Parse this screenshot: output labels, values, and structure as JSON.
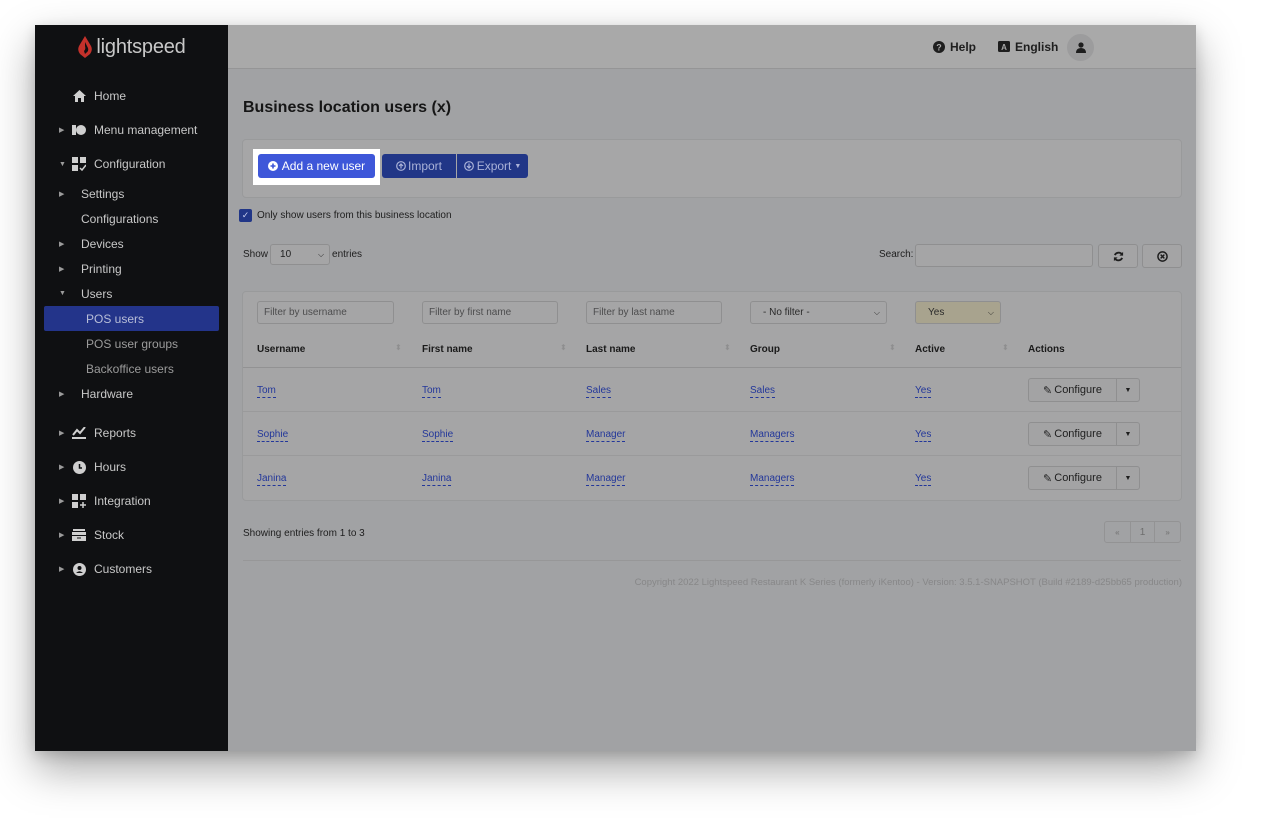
{
  "app": {
    "brand": "lightspeed",
    "brand_color": "#d0342c",
    "accent_color": "#3e57d9"
  },
  "topbar": {
    "help_label": "Help",
    "help_icon": "question-circle-icon",
    "language_label": "English",
    "language_icon": "language-icon",
    "user_icon": "user-icon"
  },
  "sidebar": {
    "items": [
      {
        "label": "Home",
        "icon": "home-icon"
      },
      {
        "label": "Menu management",
        "icon": "menu-management-icon"
      },
      {
        "label": "Configuration",
        "icon": "configuration-icon",
        "expanded": true,
        "children": [
          {
            "label": "Settings"
          },
          {
            "label": "Configurations"
          },
          {
            "label": "Devices"
          },
          {
            "label": "Printing"
          },
          {
            "label": "Users",
            "expanded": true,
            "children": [
              {
                "label": "POS users",
                "active": true
              },
              {
                "label": "POS user groups"
              },
              {
                "label": "Backoffice users"
              }
            ]
          },
          {
            "label": "Hardware"
          }
        ]
      },
      {
        "label": "Reports",
        "icon": "reports-icon"
      },
      {
        "label": "Hours",
        "icon": "clock-icon"
      },
      {
        "label": "Integration",
        "icon": "integration-icon"
      },
      {
        "label": "Stock",
        "icon": "stock-icon"
      },
      {
        "label": "Customers",
        "icon": "customer-icon"
      }
    ]
  },
  "page": {
    "title": "Business location users (x)",
    "buttons": {
      "add": "Add a new user",
      "import": "Import",
      "export": "Export"
    },
    "only_show_label": "Only show users from this business location",
    "only_show_checked": true,
    "show_label": "Show",
    "entries_value": "10",
    "entries_label": "entries",
    "search_label": "Search:",
    "search_value": ""
  },
  "table": {
    "filters": {
      "username_placeholder": "Filter by username",
      "first_name_placeholder": "Filter by first name",
      "last_name_placeholder": "Filter by last name",
      "group_value": "- No filter -",
      "active_value": "Yes"
    },
    "columns": [
      "Username",
      "First name",
      "Last name",
      "Group",
      "Active",
      "Actions"
    ],
    "rows": [
      {
        "username": "Tom",
        "first_name": "Tom",
        "last_name": "Sales",
        "group": "Sales",
        "active": "Yes",
        "action": "Configure"
      },
      {
        "username": "Sophie",
        "first_name": "Sophie",
        "last_name": "Manager",
        "group": "Managers",
        "active": "Yes",
        "action": "Configure"
      },
      {
        "username": "Janina",
        "first_name": "Janina",
        "last_name": "Manager",
        "group": "Managers",
        "active": "Yes",
        "action": "Configure"
      }
    ]
  },
  "pagination": {
    "summary": "Showing entries from 1 to 3",
    "prev": "«",
    "current": "1",
    "next": "»"
  },
  "footer": {
    "copyright": "Copyright 2022 Lightspeed Restaurant K Series (formerly iKentoo) - Version: 3.5.1-SNAPSHOT (Build #2189-d25bb65 production)"
  }
}
